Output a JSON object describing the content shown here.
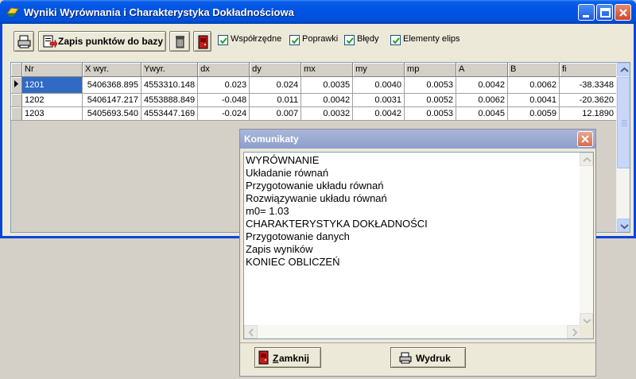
{
  "window": {
    "title": "Wyniki Wyrównania i Charakterystyka Dokładnościowa"
  },
  "toolbar": {
    "save_label": "Zapis punktów do bazy",
    "checkboxes": [
      {
        "label": "Współrzędne",
        "checked": true
      },
      {
        "label": "Poprawki",
        "checked": true
      },
      {
        "label": "Błędy",
        "checked": true
      },
      {
        "label": "Elementy elips",
        "checked": true
      }
    ]
  },
  "grid": {
    "columns": [
      "Nr",
      "X wyr.",
      "Ywyr.",
      "dx",
      "dy",
      "mx",
      "my",
      "mp",
      "A",
      "B",
      "fi"
    ],
    "rows": [
      [
        "1201",
        "5406368.895",
        "4553310.148",
        "0.023",
        "0.024",
        "0.0035",
        "0.0040",
        "0.0053",
        "0.0042",
        "0.0062",
        "-38.3348"
      ],
      [
        "1202",
        "5406147.217",
        "4553888.849",
        "-0.048",
        "0.011",
        "0.0042",
        "0.0031",
        "0.0052",
        "0.0062",
        "0.0041",
        "-20.3620"
      ],
      [
        "1203",
        "5405693.540",
        "4553447.169",
        "-0.024",
        "0.007",
        "0.0032",
        "0.0042",
        "0.0053",
        "0.0045",
        "0.0059",
        "12.1890"
      ]
    ],
    "selected_row": 0
  },
  "dialog": {
    "title": "Komunikaty",
    "lines": [
      "WYRÓWNANIE",
      "Układanie równań",
      "Przygotowanie układu równań",
      "Rozwiązywanie układu równań",
      "m0= 1.03",
      "CHARAKTERYSTYKA DOKŁADNOŚCI",
      "Przygotowanie danych",
      "Zapis wyników",
      "KONIEC OBLICZEŃ"
    ],
    "close_label_accel": "Z",
    "close_label_rest": "amknij",
    "print_label": "Wydruk"
  }
}
